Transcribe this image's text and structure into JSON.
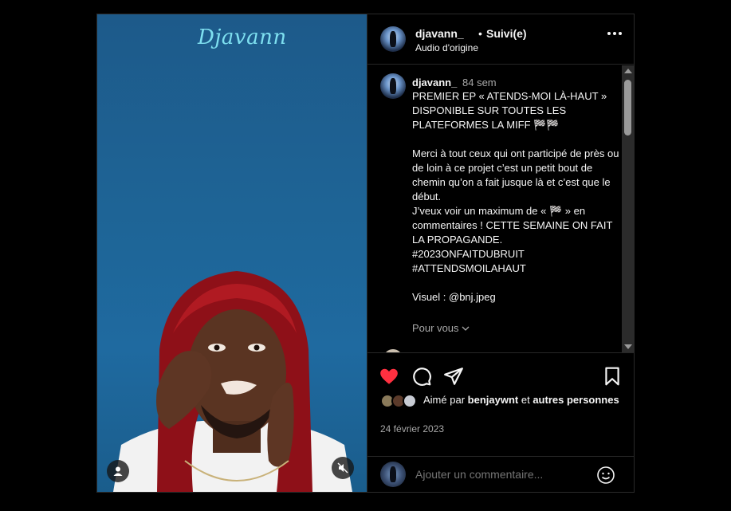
{
  "media": {
    "tag_text": "Djavann"
  },
  "header": {
    "username": "djavann_",
    "separator": "•",
    "follow_status": "Suivi(e)",
    "audio": "Audio d'origine"
  },
  "post": {
    "username": "djavann_",
    "time": "84 sem",
    "caption": "PREMIER EP « ATENDS-MOI LÀ-HAUT » DISPONIBLE SUR TOUTES LES PLATEFORMES LA MIFF 🏁🏁\n\nMerci à tout ceux qui ont participé de près ou de loin à ce projet c’est un petit bout de chemin qu’on a fait jusque là et c’est que le début.\nJ’veux voir un maximum de « 🏁 » en commentaires ! CETTE SEMAINE ON FAIT LA PROPAGANDE.\n#2023ONFAITDUBRUIT\n#ATTENDSMOILAHAUT\n\nVisuel : @bnj.jpeg",
    "translate_label": "Pour vous"
  },
  "likes": {
    "prefix": "Aimé par",
    "user": "benjaywnt",
    "joiner": "et",
    "suffix": "autres personnes"
  },
  "date": "24 février 2023",
  "comment_box": {
    "placeholder": "Ajouter un commentaire..."
  },
  "colors": {
    "like_red": "#ff3040",
    "accent_text": "#f5f5f5",
    "muted_text": "#a8a8a8"
  }
}
